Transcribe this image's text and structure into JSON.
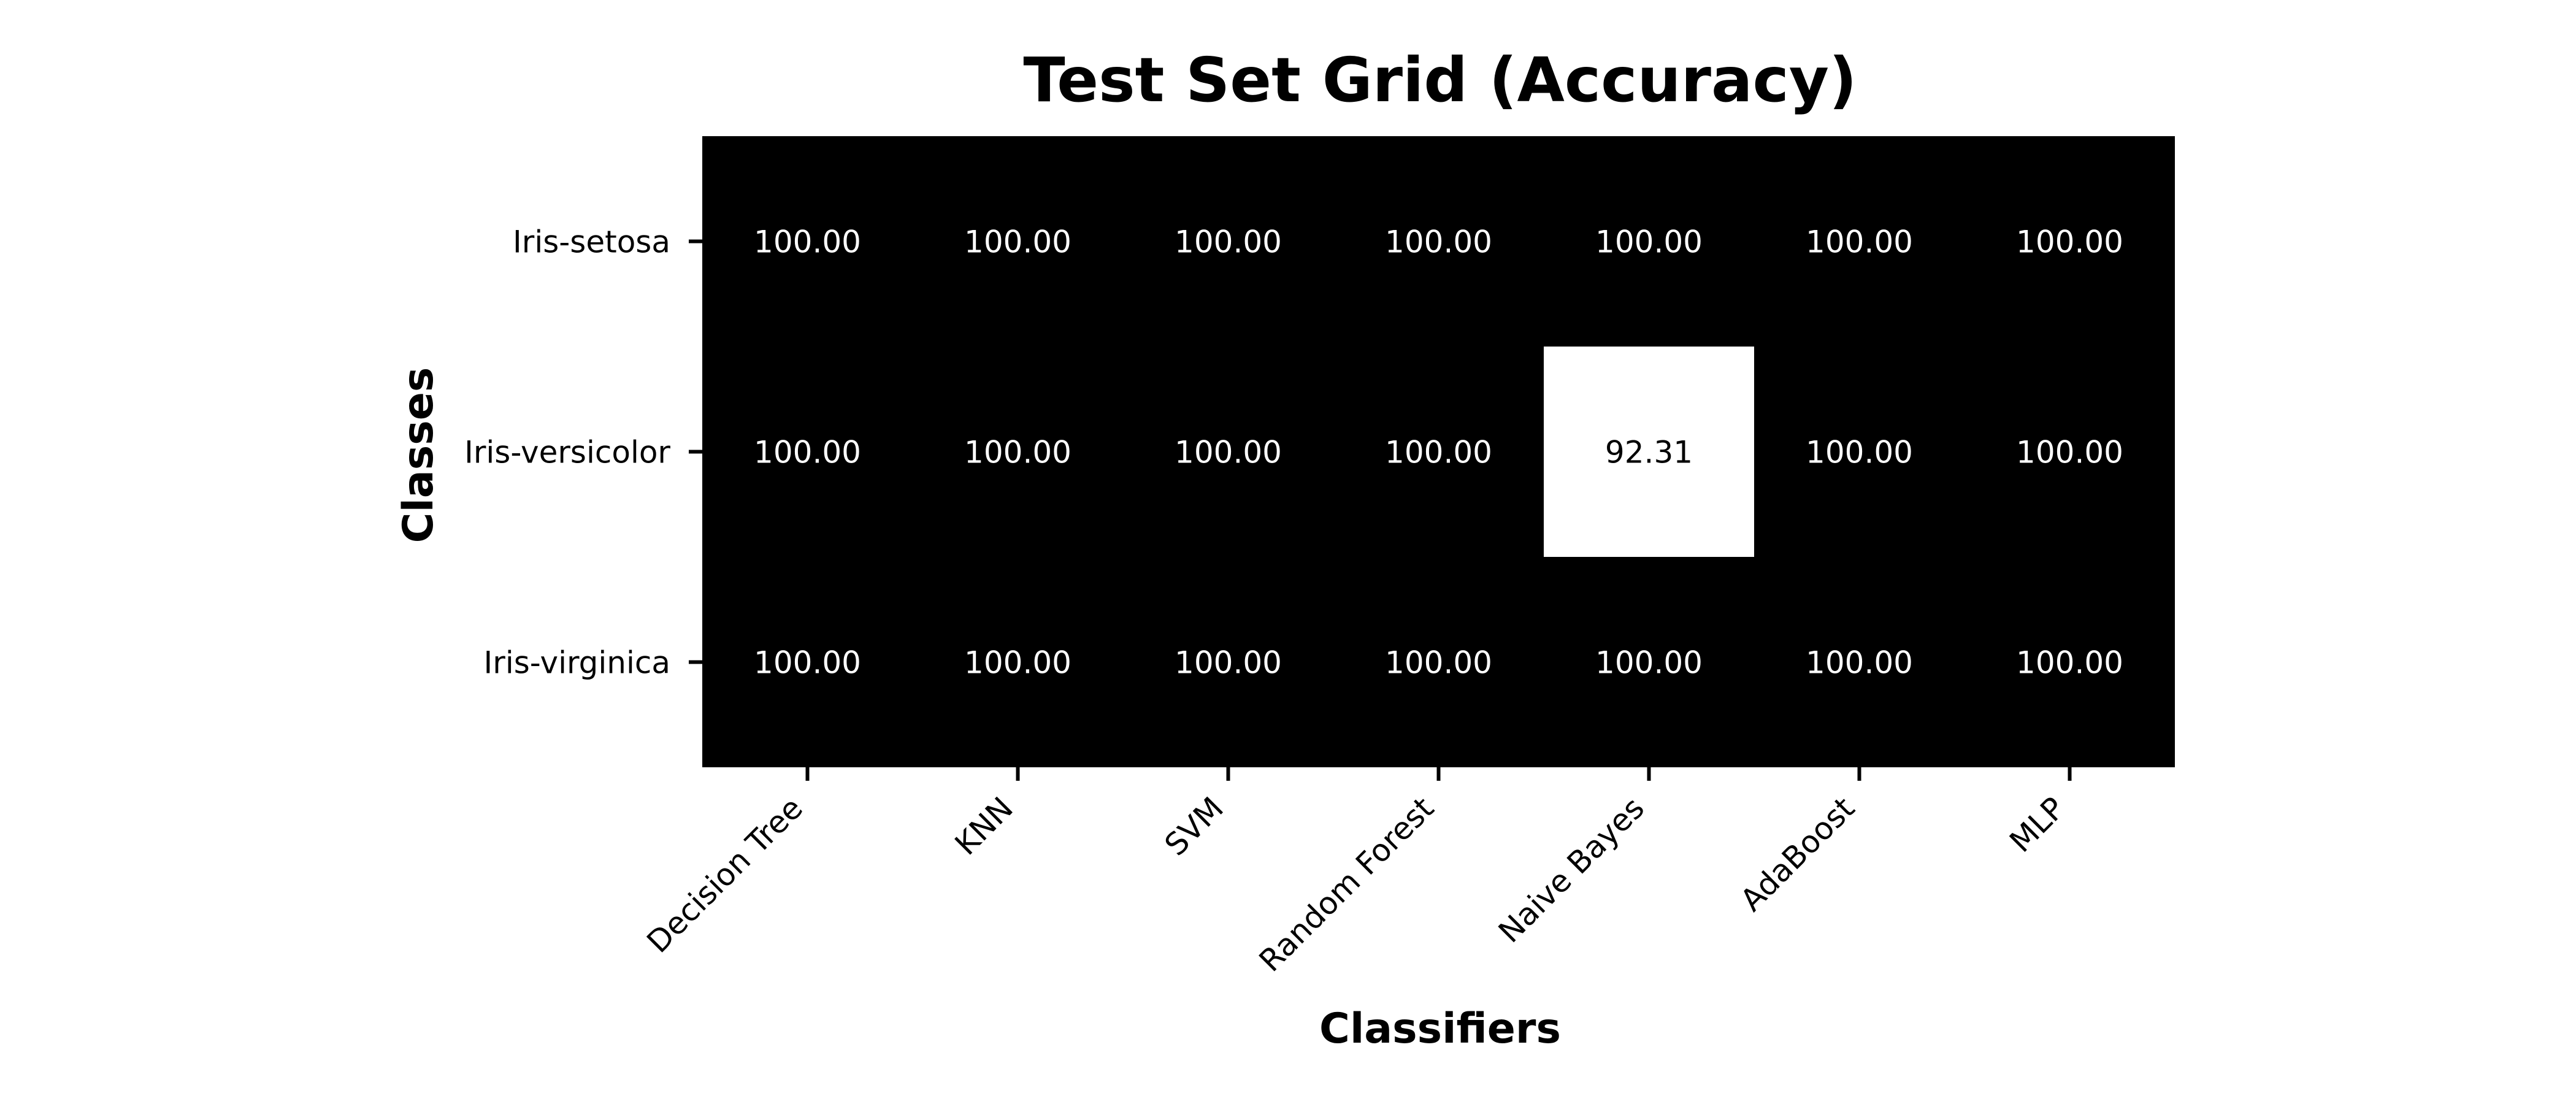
{
  "chart_data": {
    "type": "heatmap",
    "title": "Test Set Grid (Accuracy)",
    "xlabel": "Classifiers",
    "ylabel": "Classes",
    "x_categories": [
      "Decision Tree",
      "KNN",
      "SVM",
      "Random Forest",
      "Naive Bayes",
      "AdaBoost",
      "MLP"
    ],
    "y_categories": [
      "Iris-setosa",
      "Iris-versicolor",
      "Iris-virginica"
    ],
    "values": [
      [
        100.0,
        100.0,
        100.0,
        100.0,
        100.0,
        100.0,
        100.0
      ],
      [
        100.0,
        100.0,
        100.0,
        100.0,
        92.31,
        100.0,
        100.0
      ],
      [
        100.0,
        100.0,
        100.0,
        100.0,
        100.0,
        100.0,
        100.0
      ]
    ],
    "value_format": "2 decimals",
    "colormap": "grayscale, higher values darker",
    "colors": {
      "high": "#000000",
      "low": "#ffffff",
      "text_on_dark": "#ffffff",
      "text_on_light": "#000000"
    },
    "grid": false,
    "colorbar": false
  }
}
